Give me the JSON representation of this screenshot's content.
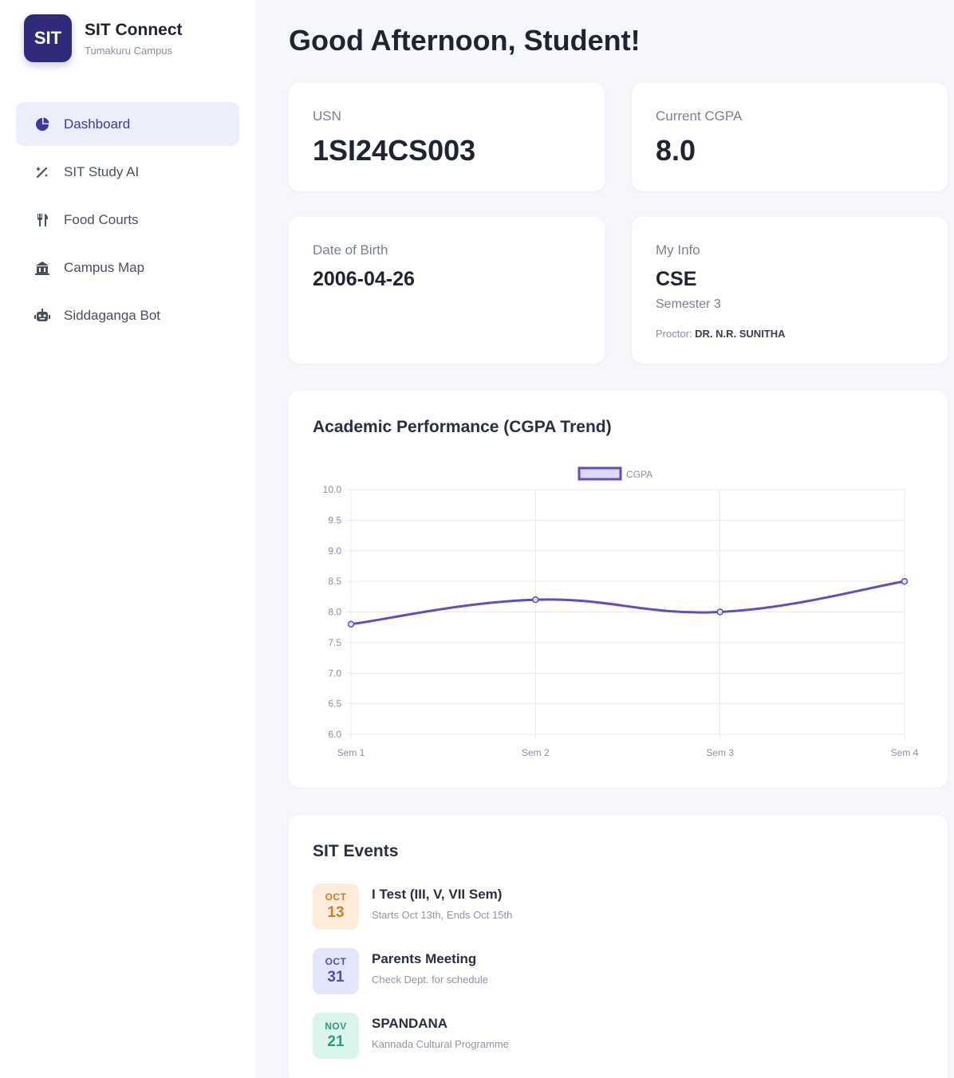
{
  "sidebar": {
    "logo_text": "SIT",
    "brand_title": "SIT Connect",
    "brand_subtitle": "Tumakuru Campus",
    "items": [
      {
        "label": "Dashboard",
        "icon": "pie-chart-icon",
        "active": true
      },
      {
        "label": "SIT Study AI",
        "icon": "magic-wand-icon",
        "active": false
      },
      {
        "label": "Food Courts",
        "icon": "utensils-icon",
        "active": false
      },
      {
        "label": "Campus Map",
        "icon": "map-icon",
        "active": false
      },
      {
        "label": "Siddaganga Bot",
        "icon": "robot-icon",
        "active": false
      }
    ]
  },
  "main": {
    "greeting": "Good Afternoon, Student!",
    "usn": {
      "label": "USN",
      "value": "1SI24CS003"
    },
    "cgpa": {
      "label": "Current CGPA",
      "value": "8.0"
    },
    "dob": {
      "label": "Date of Birth",
      "value": "2006-04-26"
    },
    "info": {
      "label": "My Info",
      "branch": "CSE",
      "semester": "Semester 3",
      "proctor_label": "Proctor:",
      "proctor_name": "DR. N.R. SUNITHA"
    },
    "performance": {
      "title": "Academic Performance (CGPA Trend)"
    },
    "events": {
      "title": "SIT Events",
      "items": [
        {
          "month": "OCT",
          "day": "13",
          "title": "I Test (III, V, VII Sem)",
          "desc": "Starts Oct 13th, Ends Oct 15th",
          "bg": "#fdecd9",
          "fg": "#d9792a"
        },
        {
          "month": "OCT",
          "day": "31",
          "title": "Parents Meeting",
          "desc": "Check Dept. for schedule",
          "bg": "#e3e6fb",
          "fg": "#4a4fbf"
        },
        {
          "month": "NOV",
          "day": "21",
          "title": "SPANDANA",
          "desc": "Kannada Cultural Programme",
          "bg": "#dcf5ec",
          "fg": "#2a9d72"
        }
      ]
    }
  },
  "chart_data": {
    "type": "line",
    "title": "",
    "xlabel": "",
    "ylabel": "",
    "categories": [
      "Sem 1",
      "Sem 2",
      "Sem 3",
      "Sem 4"
    ],
    "series": [
      {
        "name": "CGPA",
        "values": [
          7.8,
          8.2,
          8.0,
          8.5
        ],
        "color": "#5b4fc4"
      }
    ],
    "ylim": [
      6.0,
      10.0
    ],
    "yticks": [
      "10.0",
      "9.5",
      "9.0",
      "8.5",
      "8.0",
      "7.5",
      "7.0",
      "6.5",
      "6.0"
    ],
    "grid": true,
    "legend": "top-center",
    "smooth": true
  }
}
